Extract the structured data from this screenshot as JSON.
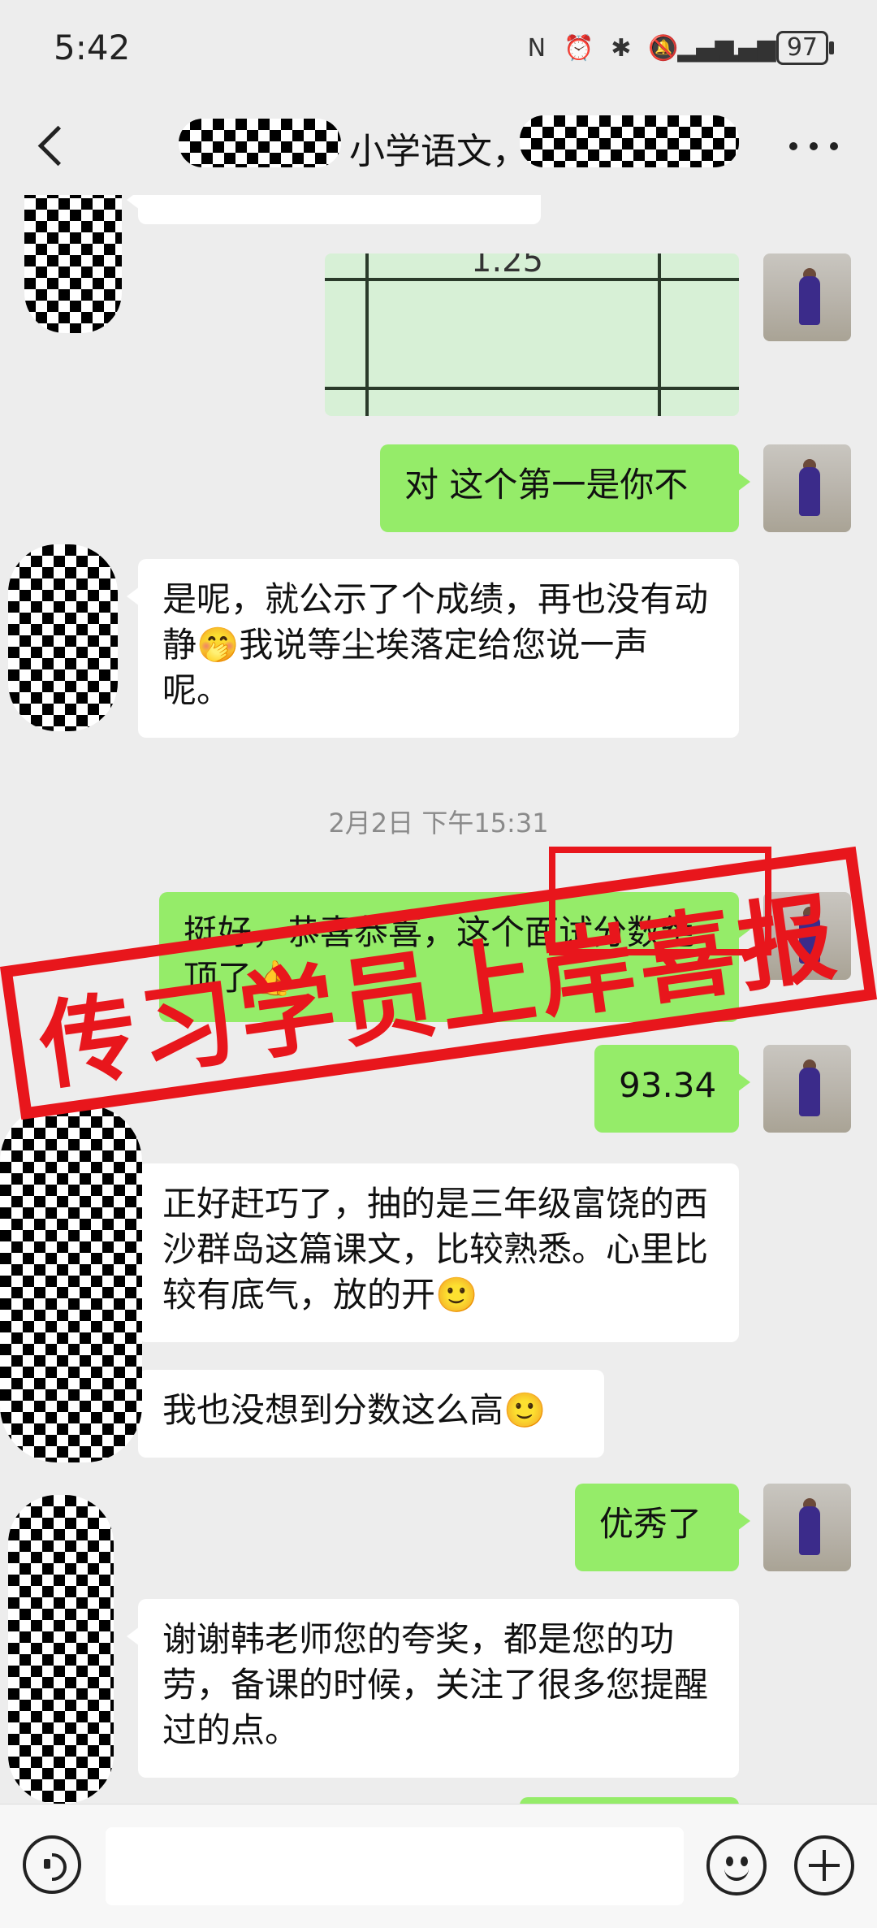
{
  "status_bar": {
    "time": "5:42",
    "battery": "97"
  },
  "header": {
    "title": "小学语文，",
    "more_icon": "more-icon"
  },
  "messages": [
    {
      "side": "out",
      "type": "image",
      "image_text": "1.25"
    },
    {
      "side": "out",
      "text": "对 这个第一是你不"
    },
    {
      "side": "in",
      "text": "是呢，就公示了个成绩，再也没有动静🤭我说等尘埃落定给您说一声呢。"
    },
    {
      "timestamp": "2月2日 下午15:31"
    },
    {
      "side": "out",
      "text": "挺好，恭喜恭喜，这个面试分数绝顶了👍"
    },
    {
      "side": "out",
      "text": "93.34"
    },
    {
      "side": "in",
      "text": "正好赶巧了，抽的是三年级富饶的西沙群岛这篇课文，比较熟悉。心里比较有底气，放的开🙂"
    },
    {
      "side": "in",
      "text": "我也没想到分数这么高🙂"
    },
    {
      "side": "out",
      "text": "优秀了"
    },
    {
      "side": "in",
      "text": "谢谢韩老师您的夸奖，都是您的功劳，备课的时候，关注了很多您提醒过的点。"
    }
  ],
  "stamp": {
    "text": "传习学员上岸喜报"
  },
  "input_bar": {
    "value": ""
  },
  "colors": {
    "outgoing_bubble": "#95ec69",
    "incoming_bubble": "#ffffff",
    "background": "#ededed",
    "stamp_red": "#e8161c"
  }
}
